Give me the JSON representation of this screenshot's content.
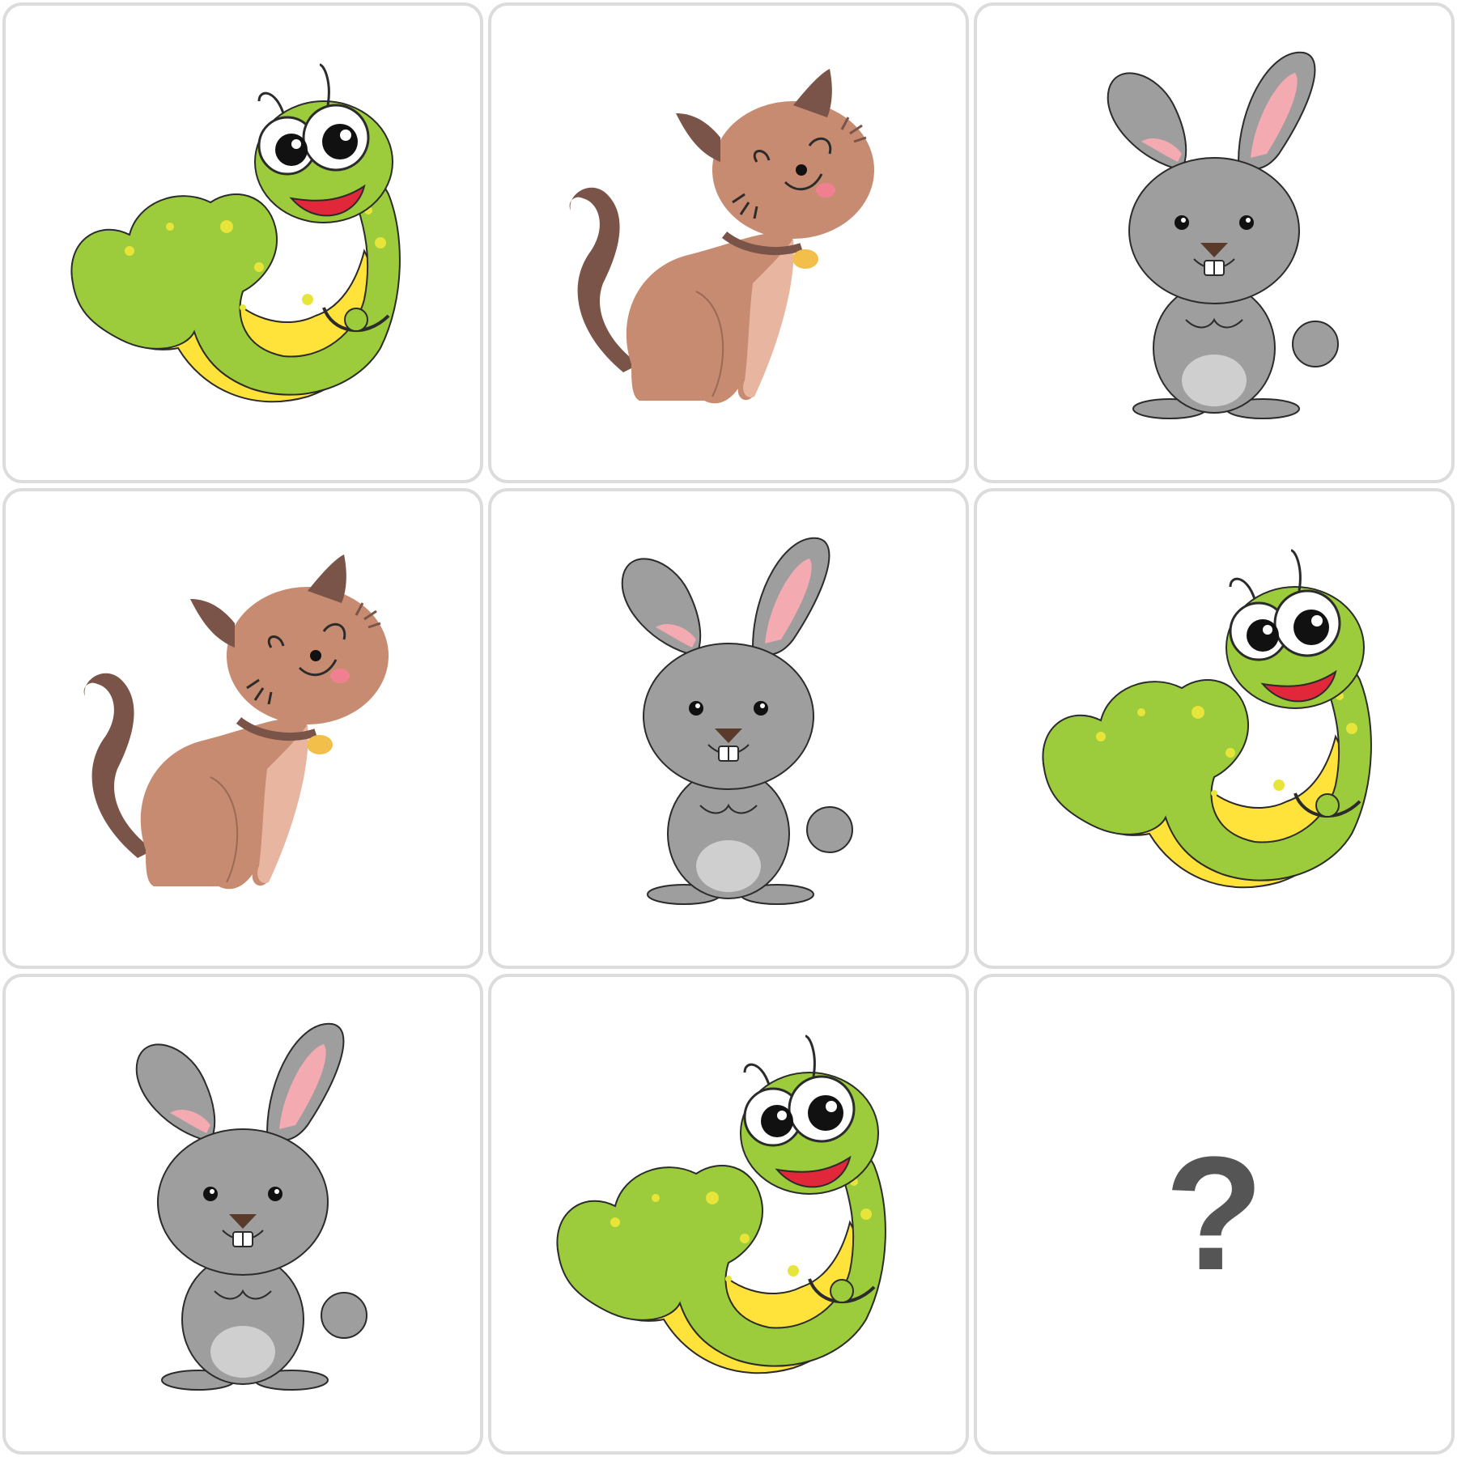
{
  "puzzle": {
    "cells": [
      {
        "animal": "caterpillar",
        "icon": "caterpillar-icon"
      },
      {
        "animal": "cat",
        "icon": "cat-icon"
      },
      {
        "animal": "rabbit",
        "icon": "rabbit-icon"
      },
      {
        "animal": "cat",
        "icon": "cat-icon"
      },
      {
        "animal": "rabbit",
        "icon": "rabbit-icon"
      },
      {
        "animal": "caterpillar",
        "icon": "caterpillar-icon"
      },
      {
        "animal": "rabbit",
        "icon": "rabbit-icon"
      },
      {
        "animal": "caterpillar",
        "icon": "caterpillar-icon"
      },
      {
        "animal": "unknown",
        "icon": "question-mark"
      }
    ],
    "missing_label": "?"
  },
  "colors": {
    "border": "#dcdcdc",
    "caterpillar_body": "#9ccb3b",
    "caterpillar_belly": "#ffe23a",
    "cat_body": "#c68b70",
    "cat_dark": "#7a5448",
    "rabbit_body": "#9e9e9e",
    "rabbit_ear": "#f3aab0",
    "question": "#555555"
  }
}
